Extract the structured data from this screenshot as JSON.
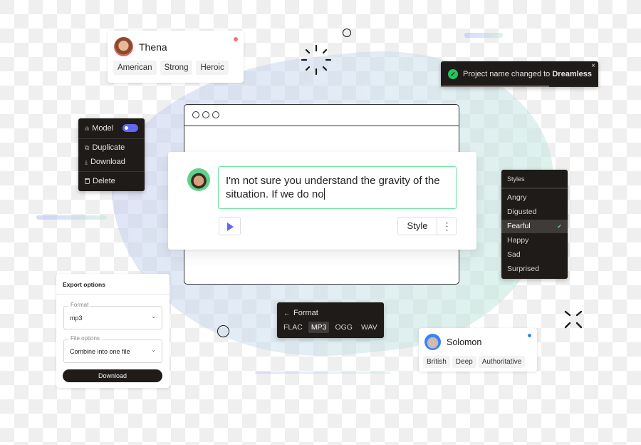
{
  "voice_cards": [
    {
      "name": "Thena",
      "tags": [
        "American",
        "Strong",
        "Heroic"
      ],
      "status_color": "#f87171"
    },
    {
      "name": "Solomon",
      "tags": [
        "British",
        "Deep",
        "Authoritative"
      ],
      "status_color": "#3b82f6"
    }
  ],
  "toast": {
    "message_prefix": "Project name changed to ",
    "message_bold": "Dreamless",
    "icon": "check-circle-icon",
    "close_icon": "close-icon",
    "close_glyph": "×",
    "success_color": "#22c55e"
  },
  "context_menu": {
    "items": [
      {
        "label": "Model",
        "icon": "waveform-icon",
        "glyph": "ılı",
        "toggle": true,
        "toggle_on": true
      },
      {
        "label": "Duplicate",
        "icon": "duplicate-icon",
        "glyph": "⧉"
      },
      {
        "label": "Download",
        "icon": "download-icon",
        "glyph": "⤓"
      },
      {
        "label": "Delete",
        "icon": "trash-icon",
        "glyph": "🗑"
      }
    ],
    "accent": "#6366f1"
  },
  "editor": {
    "text": "I'm not sure you understand the gravity of the situation. If we do no",
    "play_icon": "play-icon",
    "style_button": "Style",
    "more_icon": "more-vertical-icon",
    "more_glyph": "⋮",
    "accent": "#6366f1",
    "border_color": "#6ee7a0"
  },
  "styles_menu": {
    "title": "Styles",
    "items": [
      "Angry",
      "Digusted",
      "Fearful",
      "Happy",
      "Sad",
      "Surprised"
    ],
    "selected": "Fearful",
    "check_glyph": "✔"
  },
  "export_options": {
    "title": "Export options",
    "format_label": "Format",
    "format_value": "mp3",
    "file_options_label": "File options",
    "file_options_value": "Combine into one file",
    "chevron_glyph": "⌄",
    "download_button": "Download"
  },
  "format_menu": {
    "back_glyph": "←",
    "title": "Format",
    "options": [
      "FLAC",
      "MP3",
      "OGG",
      "WAV"
    ],
    "selected": "MP3"
  }
}
